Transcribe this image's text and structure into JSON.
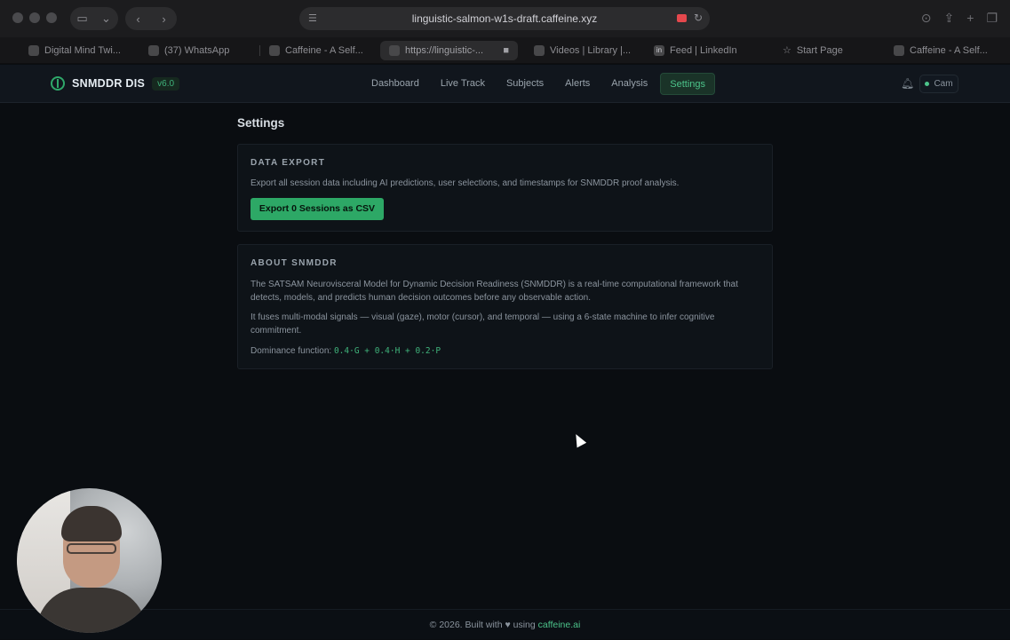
{
  "browser": {
    "url": "linguistic-salmon-w1s-draft.caffeine.xyz",
    "tabs": [
      {
        "label": "Digital Mind Twi...",
        "active": false
      },
      {
        "label": "(37) WhatsApp",
        "active": false
      },
      {
        "label": "Caffeine - A Self...",
        "active": false
      },
      {
        "label": "https://linguistic-...",
        "active": true
      },
      {
        "label": "Videos | Library |...",
        "active": false
      },
      {
        "label": "Feed | LinkedIn",
        "active": false
      },
      {
        "label": "Start Page",
        "active": false
      },
      {
        "label": "Caffeine - A Self...",
        "active": false
      }
    ]
  },
  "header": {
    "brand": "SNMDDR DIS",
    "version": "v6.0",
    "nav": [
      {
        "label": "Dashboard",
        "active": false
      },
      {
        "label": "Live Track",
        "active": false
      },
      {
        "label": "Subjects",
        "active": false
      },
      {
        "label": "Alerts",
        "active": false
      },
      {
        "label": "Analysis",
        "active": false
      },
      {
        "label": "Settings",
        "active": true
      }
    ],
    "cam_label": "Cam",
    "cam_status_color": "#4cc38a"
  },
  "page": {
    "title": "Settings",
    "export": {
      "heading": "DATA EXPORT",
      "description": "Export all session data including AI predictions, user selections, and timestamps for SNMDDR proof analysis.",
      "button_label": "Export 0 Sessions as CSV"
    },
    "about": {
      "heading": "ABOUT SNMDDR",
      "para1": "The SATSAM Neurovisceral Model for Dynamic Decision Readiness (SNMDDR) is a real-time computational framework that detects, models, and predicts human decision outcomes before any observable action.",
      "para2": "It fuses multi-modal signals — visual (gaze), motor (cursor), and temporal — using a 6-state machine to infer cognitive commitment.",
      "dominance_label": "Dominance function: ",
      "dominance_formula": "0.4·G + 0.4·H + 0.2·P"
    }
  },
  "footer": {
    "prefix": "© 2026. Built with ♥ using ",
    "link": "caffeine.ai"
  },
  "colors": {
    "accent": "#2da866",
    "background": "#0a0d11",
    "card": "#0e1318"
  }
}
